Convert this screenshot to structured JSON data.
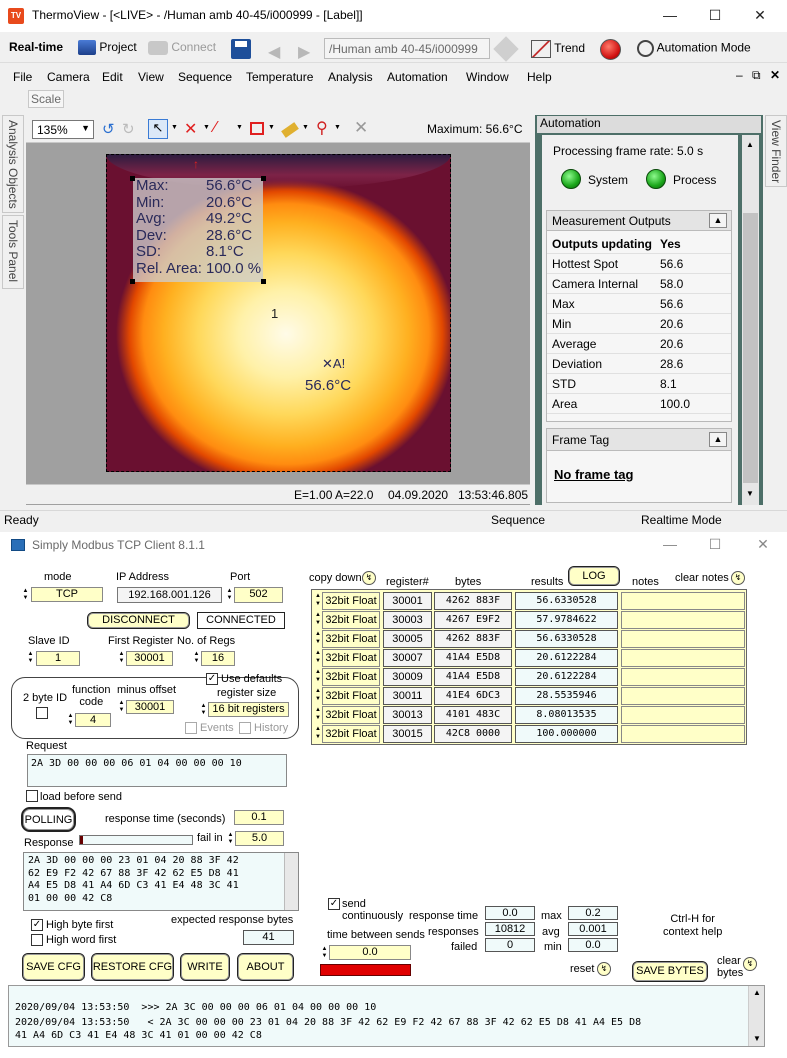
{
  "thermoview": {
    "title": "ThermoView - [<LIVE> - /Human amb 40-45/i000999 - [Label]]",
    "toolbar": {
      "realtime": "Real-time",
      "project": "Project",
      "connect": "Connect",
      "path": "/Human amb 40-45/i000999",
      "trend": "Trend",
      "automation_mode": "Automation Mode"
    },
    "menu": [
      "File",
      "Camera",
      "Edit",
      "View",
      "Sequence",
      "Temperature",
      "Analysis",
      "Automation",
      "Window",
      "Help"
    ],
    "scale": "Scale",
    "left_tabs": [
      "Analysis Objects",
      "Tools Panel"
    ],
    "right_tab": "View Finder",
    "image_toolbar": {
      "zoom": "135%",
      "maximum": "Maximum: 56.6°C"
    },
    "stats": [
      {
        "label": "Max:",
        "value": "56.6°C"
      },
      {
        "label": "Min:",
        "value": "20.6°C"
      },
      {
        "label": "Avg:",
        "value": "49.2°C"
      },
      {
        "label": "Dev:",
        "value": "28.6°C"
      },
      {
        "label": "SD:",
        "value": "8.1°C"
      },
      {
        "label": "Rel. Area:",
        "value": "100.0 %"
      }
    ],
    "marker_number": "1",
    "hotspot_marker": "✕A!",
    "hotspot_temp": "56.6°C",
    "image_status": {
      "ea": "E=1.00 A=22.0",
      "date": "04.09.2020",
      "time": "13:53:46.805"
    },
    "automation": {
      "header": "Automation",
      "processing_rate": "Processing frame rate: 5.0 s",
      "system": "System",
      "process": "Process",
      "outputs_header": "Measurement Outputs",
      "outputs": [
        {
          "label": "Outputs updating",
          "value": "Yes"
        },
        {
          "label": "Hottest Spot",
          "value": "56.6"
        },
        {
          "label": "Camera Internal",
          "value": "58.0"
        },
        {
          "label": "Max",
          "value": "56.6"
        },
        {
          "label": "Min",
          "value": "20.6"
        },
        {
          "label": "Average",
          "value": "20.6"
        },
        {
          "label": "Deviation",
          "value": "28.6"
        },
        {
          "label": "STD",
          "value": "8.1"
        },
        {
          "label": "Area",
          "value": "100.0"
        }
      ],
      "frame_tag_header": "Frame Tag",
      "frame_tag": "No frame tag"
    },
    "status": {
      "ready": "Ready",
      "sequence": "Sequence",
      "mode": "Realtime Mode"
    }
  },
  "modbus": {
    "title": "Simply Modbus TCP Client 8.1.1",
    "mode_label": "mode",
    "mode": "TCP",
    "ip_label": "IP Address",
    "ip": "192.168.001.126",
    "port_label": "Port",
    "port": "502",
    "disconnect": "DISCONNECT",
    "connected": "CONNECTED",
    "slave_label": "Slave ID",
    "slave": "1",
    "first_reg_label": "First Register",
    "first_reg": "30001",
    "num_regs_label": "No. of Regs",
    "num_regs": "16",
    "use_defaults": "Use defaults",
    "two_byte_id": "2 byte ID",
    "function_code_label": "function\ncode",
    "function_code": "4",
    "minus_offset_label": "minus offset",
    "minus_offset": "30001",
    "register_size_label": "register size",
    "register_size": "16 bit registers",
    "events": "Events",
    "history": "History",
    "request_label": "Request",
    "request": "2A 3D 00 00 00 06 01 04 00 00 00 10",
    "load_before_send": "load before send",
    "polling": "POLLING",
    "response_time_label": "response time (seconds)",
    "response_time": "0.1",
    "fail_in_label": "fail in",
    "fail_in": "5.0",
    "response_label": "Response",
    "response": "2A 3D 00 00 00 23 01 04 20 88 3F 42\n62 E9 F2 42 67 88 3F 42 62 E5 D8 41\nA4 E5 D8 41 A4 6D C3 41 E4 48 3C 41\n01 00 00 42 C8",
    "high_byte_first": "High byte first",
    "high_word_first": "High word first",
    "expected_bytes_label": "expected response bytes",
    "expected_bytes": "41",
    "save_cfg": "SAVE CFG",
    "restore_cfg": "RESTORE CFG",
    "write": "WRITE",
    "about": "ABOUT",
    "copy_down": "copy down",
    "register_hdr": "register#",
    "bytes_hdr": "bytes",
    "results_hdr": "results",
    "log": "LOG",
    "notes_hdr": "notes",
    "clear_notes": "clear notes",
    "rows": [
      {
        "type": "32bit Float",
        "reg": "30001",
        "bytes": "4262 883F",
        "result": "56.6330528"
      },
      {
        "type": "32bit Float",
        "reg": "30003",
        "bytes": "4267 E9F2",
        "result": "57.9784622"
      },
      {
        "type": "32bit Float",
        "reg": "30005",
        "bytes": "4262 883F",
        "result": "56.6330528"
      },
      {
        "type": "32bit Float",
        "reg": "30007",
        "bytes": "41A4 E5D8",
        "result": "20.6122284"
      },
      {
        "type": "32bit Float",
        "reg": "30009",
        "bytes": "41A4 E5D8",
        "result": "20.6122284"
      },
      {
        "type": "32bit Float",
        "reg": "30011",
        "bytes": "41E4 6DC3",
        "result": "28.5535946"
      },
      {
        "type": "32bit Float",
        "reg": "30013",
        "bytes": "4101 483C",
        "result": "8.08013535"
      },
      {
        "type": "32bit Float",
        "reg": "30015",
        "bytes": "42C8 0000",
        "result": "100.000000"
      }
    ],
    "send_continuously": "send\ncontinuously",
    "time_between_sends_label": "time between sends",
    "time_between_sends": "0.0",
    "stats_labels": {
      "response_time": "response time",
      "responses": "responses",
      "failed": "failed",
      "max": "max",
      "avg": "avg",
      "min": "min"
    },
    "stats_values": {
      "response_time": "0.0",
      "responses": "10812",
      "failed": "0",
      "max": "0.2",
      "avg": "0.001",
      "min": "0.0"
    },
    "ctrl_h": "Ctrl-H for\ncontext help",
    "reset": "reset",
    "save_bytes": "SAVE BYTES",
    "clear_bytes": "clear\nbytes",
    "log_lines": [
      "2020/09/04 13:53:50  >>> 2A 3C 00 00 00 06 01 04 00 00 00 10",
      "2020/09/04 13:53:50   < 2A 3C 00 00 00 23 01 04 20 88 3F 42 62 E9 F2 42 67 88 3F 42 62 E5 D8 41 A4 E5 D8",
      "41 A4 6D C3 41 E4 48 3C 41 01 00 00 42 C8"
    ]
  },
  "colors": {
    "accent_green": "#22aa22",
    "panel_teal": "#4d6f68",
    "yellow_field": "#ffffc8",
    "red_bar": "#e00000"
  }
}
